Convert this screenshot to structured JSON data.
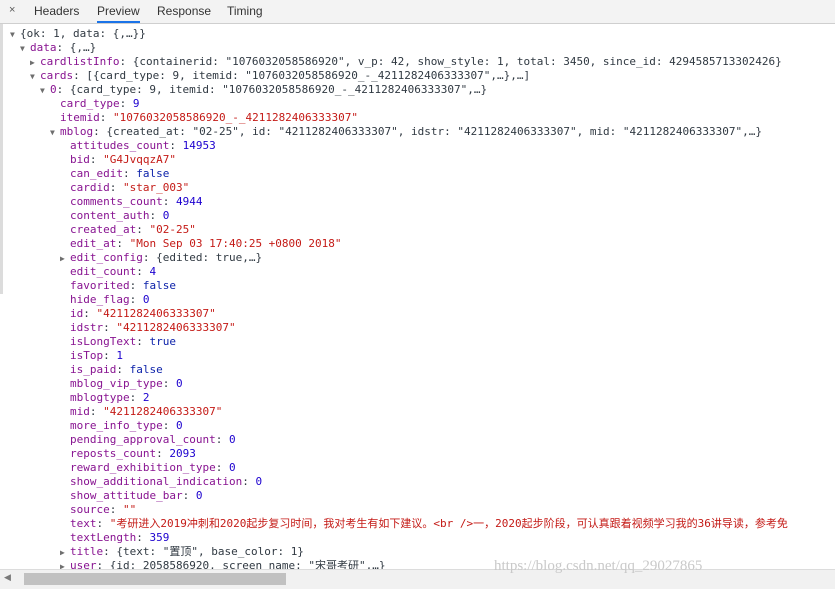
{
  "tabs": {
    "close": "×",
    "items": [
      {
        "label": "Headers",
        "active": false
      },
      {
        "label": "Preview",
        "active": true
      },
      {
        "label": "Response",
        "active": false
      },
      {
        "label": "Timing",
        "active": false
      }
    ]
  },
  "lines": [
    {
      "depth": 0,
      "toggle": "expanded",
      "segments": [
        {
          "t": "{ok: 1, data: {,…}}",
          "c": "p"
        }
      ]
    },
    {
      "depth": 1,
      "toggle": "expanded",
      "segments": [
        {
          "t": "data",
          "c": "k"
        },
        {
          "t": ": {,…}",
          "c": "p"
        }
      ]
    },
    {
      "depth": 2,
      "toggle": "collapsed",
      "segments": [
        {
          "t": "cardlistInfo",
          "c": "k"
        },
        {
          "t": ": {containerid: \"1076032058586920\", v_p: 42, show_style: 1, total: 3450, since_id: 4294585713302426}",
          "c": "p"
        }
      ]
    },
    {
      "depth": 2,
      "toggle": "expanded",
      "segments": [
        {
          "t": "cards",
          "c": "k"
        },
        {
          "t": ": [{card_type: 9, itemid: \"1076032058586920_-_4211282406333307\",…},…]",
          "c": "p"
        }
      ]
    },
    {
      "depth": 3,
      "toggle": "expanded",
      "segments": [
        {
          "t": "0",
          "c": "k"
        },
        {
          "t": ": {card_type: 9, itemid: \"1076032058586920_-_4211282406333307\",…}",
          "c": "p"
        }
      ]
    },
    {
      "depth": 4,
      "toggle": "none",
      "segments": [
        {
          "t": "card_type",
          "c": "k"
        },
        {
          "t": ": ",
          "c": "p"
        },
        {
          "t": "9",
          "c": "n"
        }
      ]
    },
    {
      "depth": 4,
      "toggle": "none",
      "segments": [
        {
          "t": "itemid",
          "c": "k"
        },
        {
          "t": ": ",
          "c": "p"
        },
        {
          "t": "\"1076032058586920_-_4211282406333307\"",
          "c": "s"
        }
      ]
    },
    {
      "depth": 4,
      "toggle": "expanded",
      "segments": [
        {
          "t": "mblog",
          "c": "k"
        },
        {
          "t": ": {created_at: \"02-25\", id: \"4211282406333307\", idstr: \"4211282406333307\", mid: \"4211282406333307\",…}",
          "c": "p"
        }
      ]
    },
    {
      "depth": 5,
      "toggle": "none",
      "segments": [
        {
          "t": "attitudes_count",
          "c": "k"
        },
        {
          "t": ": ",
          "c": "p"
        },
        {
          "t": "14953",
          "c": "n"
        }
      ]
    },
    {
      "depth": 5,
      "toggle": "none",
      "segments": [
        {
          "t": "bid",
          "c": "k"
        },
        {
          "t": ": ",
          "c": "p"
        },
        {
          "t": "\"G4JvqqzA7\"",
          "c": "s"
        }
      ]
    },
    {
      "depth": 5,
      "toggle": "none",
      "segments": [
        {
          "t": "can_edit",
          "c": "k"
        },
        {
          "t": ": ",
          "c": "p"
        },
        {
          "t": "false",
          "c": "b"
        }
      ]
    },
    {
      "depth": 5,
      "toggle": "none",
      "segments": [
        {
          "t": "cardid",
          "c": "k"
        },
        {
          "t": ": ",
          "c": "p"
        },
        {
          "t": "\"star_003\"",
          "c": "s"
        }
      ]
    },
    {
      "depth": 5,
      "toggle": "none",
      "segments": [
        {
          "t": "comments_count",
          "c": "k"
        },
        {
          "t": ": ",
          "c": "p"
        },
        {
          "t": "4944",
          "c": "n"
        }
      ]
    },
    {
      "depth": 5,
      "toggle": "none",
      "segments": [
        {
          "t": "content_auth",
          "c": "k"
        },
        {
          "t": ": ",
          "c": "p"
        },
        {
          "t": "0",
          "c": "n"
        }
      ]
    },
    {
      "depth": 5,
      "toggle": "none",
      "segments": [
        {
          "t": "created_at",
          "c": "k"
        },
        {
          "t": ": ",
          "c": "p"
        },
        {
          "t": "\"02-25\"",
          "c": "s"
        }
      ]
    },
    {
      "depth": 5,
      "toggle": "none",
      "segments": [
        {
          "t": "edit_at",
          "c": "k"
        },
        {
          "t": ": ",
          "c": "p"
        },
        {
          "t": "\"Mon Sep 03 17:40:25 +0800 2018\"",
          "c": "s"
        }
      ]
    },
    {
      "depth": 5,
      "toggle": "collapsed",
      "segments": [
        {
          "t": "edit_config",
          "c": "k"
        },
        {
          "t": ": {edited: true,…}",
          "c": "p"
        }
      ]
    },
    {
      "depth": 5,
      "toggle": "none",
      "segments": [
        {
          "t": "edit_count",
          "c": "k"
        },
        {
          "t": ": ",
          "c": "p"
        },
        {
          "t": "4",
          "c": "n"
        }
      ]
    },
    {
      "depth": 5,
      "toggle": "none",
      "segments": [
        {
          "t": "favorited",
          "c": "k"
        },
        {
          "t": ": ",
          "c": "p"
        },
        {
          "t": "false",
          "c": "b"
        }
      ]
    },
    {
      "depth": 5,
      "toggle": "none",
      "segments": [
        {
          "t": "hide_flag",
          "c": "k"
        },
        {
          "t": ": ",
          "c": "p"
        },
        {
          "t": "0",
          "c": "n"
        }
      ]
    },
    {
      "depth": 5,
      "toggle": "none",
      "segments": [
        {
          "t": "id",
          "c": "k"
        },
        {
          "t": ": ",
          "c": "p"
        },
        {
          "t": "\"4211282406333307\"",
          "c": "s"
        }
      ]
    },
    {
      "depth": 5,
      "toggle": "none",
      "segments": [
        {
          "t": "idstr",
          "c": "k"
        },
        {
          "t": ": ",
          "c": "p"
        },
        {
          "t": "\"4211282406333307\"",
          "c": "s"
        }
      ]
    },
    {
      "depth": 5,
      "toggle": "none",
      "segments": [
        {
          "t": "isLongText",
          "c": "k"
        },
        {
          "t": ": ",
          "c": "p"
        },
        {
          "t": "true",
          "c": "b"
        }
      ]
    },
    {
      "depth": 5,
      "toggle": "none",
      "segments": [
        {
          "t": "isTop",
          "c": "k"
        },
        {
          "t": ": ",
          "c": "p"
        },
        {
          "t": "1",
          "c": "n"
        }
      ]
    },
    {
      "depth": 5,
      "toggle": "none",
      "segments": [
        {
          "t": "is_paid",
          "c": "k"
        },
        {
          "t": ": ",
          "c": "p"
        },
        {
          "t": "false",
          "c": "b"
        }
      ]
    },
    {
      "depth": 5,
      "toggle": "none",
      "segments": [
        {
          "t": "mblog_vip_type",
          "c": "k"
        },
        {
          "t": ": ",
          "c": "p"
        },
        {
          "t": "0",
          "c": "n"
        }
      ]
    },
    {
      "depth": 5,
      "toggle": "none",
      "segments": [
        {
          "t": "mblogtype",
          "c": "k"
        },
        {
          "t": ": ",
          "c": "p"
        },
        {
          "t": "2",
          "c": "n"
        }
      ]
    },
    {
      "depth": 5,
      "toggle": "none",
      "segments": [
        {
          "t": "mid",
          "c": "k"
        },
        {
          "t": ": ",
          "c": "p"
        },
        {
          "t": "\"4211282406333307\"",
          "c": "s"
        }
      ]
    },
    {
      "depth": 5,
      "toggle": "none",
      "segments": [
        {
          "t": "more_info_type",
          "c": "k"
        },
        {
          "t": ": ",
          "c": "p"
        },
        {
          "t": "0",
          "c": "n"
        }
      ]
    },
    {
      "depth": 5,
      "toggle": "none",
      "segments": [
        {
          "t": "pending_approval_count",
          "c": "k"
        },
        {
          "t": ": ",
          "c": "p"
        },
        {
          "t": "0",
          "c": "n"
        }
      ]
    },
    {
      "depth": 5,
      "toggle": "none",
      "segments": [
        {
          "t": "reposts_count",
          "c": "k"
        },
        {
          "t": ": ",
          "c": "p"
        },
        {
          "t": "2093",
          "c": "n"
        }
      ]
    },
    {
      "depth": 5,
      "toggle": "none",
      "segments": [
        {
          "t": "reward_exhibition_type",
          "c": "k"
        },
        {
          "t": ": ",
          "c": "p"
        },
        {
          "t": "0",
          "c": "n"
        }
      ]
    },
    {
      "depth": 5,
      "toggle": "none",
      "segments": [
        {
          "t": "show_additional_indication",
          "c": "k"
        },
        {
          "t": ": ",
          "c": "p"
        },
        {
          "t": "0",
          "c": "n"
        }
      ]
    },
    {
      "depth": 5,
      "toggle": "none",
      "segments": [
        {
          "t": "show_attitude_bar",
          "c": "k"
        },
        {
          "t": ": ",
          "c": "p"
        },
        {
          "t": "0",
          "c": "n"
        }
      ]
    },
    {
      "depth": 5,
      "toggle": "none",
      "segments": [
        {
          "t": "source",
          "c": "k"
        },
        {
          "t": ": ",
          "c": "p"
        },
        {
          "t": "\"\"",
          "c": "s"
        }
      ]
    },
    {
      "depth": 5,
      "toggle": "none",
      "segments": [
        {
          "t": "text",
          "c": "k"
        },
        {
          "t": ": ",
          "c": "p"
        },
        {
          "t": "\"考研进入2019冲刺和2020起步复习时间，我对考生有如下建议。<br />一，2020起步阶段，可认真跟着视频学习我的36讲导读，参考免",
          "c": "s"
        }
      ]
    },
    {
      "depth": 5,
      "toggle": "none",
      "segments": [
        {
          "t": "textLength",
          "c": "k"
        },
        {
          "t": ": ",
          "c": "p"
        },
        {
          "t": "359",
          "c": "n"
        }
      ]
    },
    {
      "depth": 5,
      "toggle": "collapsed",
      "segments": [
        {
          "t": "title",
          "c": "k"
        },
        {
          "t": ": {text: \"置顶\", base_color: 1}",
          "c": "p"
        }
      ]
    },
    {
      "depth": 5,
      "toggle": "collapsed",
      "segments": [
        {
          "t": "user",
          "c": "k"
        },
        {
          "t": ": {id: 2058586920, screen_name: \"宋哥考研\",…}",
          "c": "p"
        }
      ]
    }
  ],
  "watermark": "https://blog.csdn.net/qq_29027865"
}
